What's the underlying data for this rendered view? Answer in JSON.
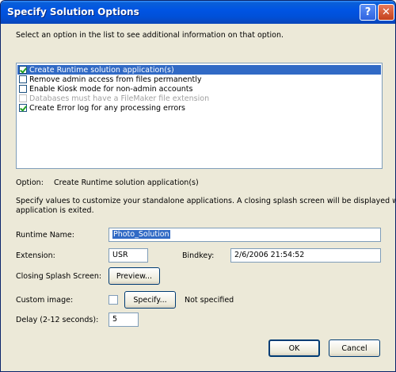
{
  "window": {
    "title": "Specify Solution Options"
  },
  "instructions": "Select an option in the list to see additional information on that option.",
  "options_list": {
    "items": [
      {
        "label": "Create Runtime solution application(s)",
        "checked": true,
        "selected": true,
        "disabled": false
      },
      {
        "label": "Remove admin access from files permanently",
        "checked": false,
        "selected": false,
        "disabled": false
      },
      {
        "label": "Enable Kiosk mode for non-admin accounts",
        "checked": false,
        "selected": false,
        "disabled": false
      },
      {
        "label": "Databases must have a FileMaker file extension",
        "checked": false,
        "selected": false,
        "disabled": true
      },
      {
        "label": "Create Error log for any processing errors",
        "checked": true,
        "selected": false,
        "disabled": false
      }
    ]
  },
  "option_info": {
    "label": "Option:",
    "value": "Create Runtime solution application(s)"
  },
  "description": {
    "line1": "Specify values to customize your standalone applications. A closing splash screen will be displayed when the",
    "line2": "application is exited."
  },
  "form": {
    "runtime_name_label": "Runtime Name:",
    "runtime_name_value": "Photo_Solution",
    "extension_label": "Extension:",
    "extension_value": "USR",
    "bindkey_label": "Bindkey:",
    "bindkey_value": "2/6/2006 21:54:52",
    "closing_splash_label": "Closing Splash Screen:",
    "preview_button": "Preview...",
    "custom_image_label": "Custom image:",
    "custom_image_checked": false,
    "specify_button": "Specify...",
    "custom_image_status": "Not specified",
    "delay_label": "Delay (2-12 seconds):",
    "delay_value": "5"
  },
  "footer": {
    "ok_label": "OK",
    "cancel_label": "Cancel"
  },
  "colors": {
    "titlebar": "#0054e3",
    "selection": "#316ac5",
    "dialog_bg": "#ece9d8"
  }
}
